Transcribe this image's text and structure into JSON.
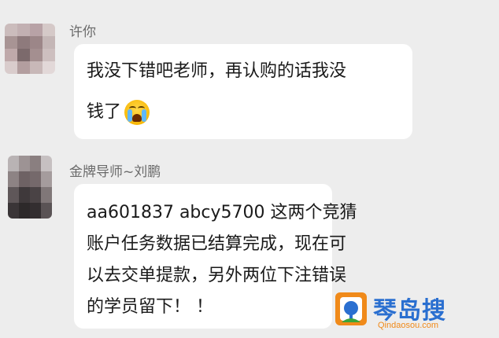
{
  "messages": [
    {
      "sender": "许你",
      "lines": [
        "我没下错吧老师，再认购的话我没",
        "钱了"
      ],
      "emoji": "loudly-crying-face"
    },
    {
      "sender": "金牌导师~刘鹏",
      "lines": [
        "aa601837   abcy5700  这两个竞猜",
        "账户任务数据已结算完成，现在可",
        "以去交单提款，另外两位下注错误",
        "的学员留下！ ！"
      ]
    }
  ],
  "watermark": {
    "title": "琴岛搜",
    "domain": "Qindaosou.com"
  },
  "colors": {
    "background": "#ededed",
    "bubble": "#ffffff",
    "text": "#1a1a1a",
    "sender": "#6a6a6a",
    "watermark_blue": "#2a6fd0",
    "watermark_orange": "#f08a1a"
  }
}
